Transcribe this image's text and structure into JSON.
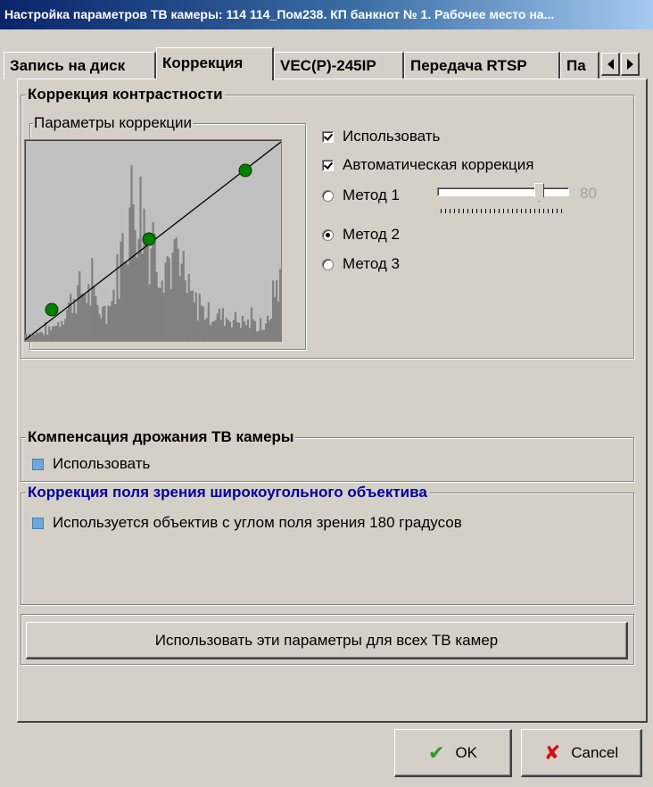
{
  "window": {
    "title": "Настройка параметров ТВ камеры: 114 114_Пом238. КП банкнот № 1. Рабочее место на..."
  },
  "tabs": [
    {
      "label": "Запись на диск",
      "active": false
    },
    {
      "label": "Коррекция",
      "active": true
    },
    {
      "label": "VEC(P)-245IP",
      "active": false
    },
    {
      "label": "Передача RTSP",
      "active": false
    },
    {
      "label": "Па",
      "active": false
    }
  ],
  "contrast": {
    "group_title": "Коррекция контрастности",
    "params_title": "Параметры коррекции",
    "use_label": "Использовать",
    "use_checked": true,
    "auto_label": "Автоматическая коррекция",
    "auto_checked": true,
    "methods": [
      {
        "label": "Метод 1",
        "selected": false
      },
      {
        "label": "Метод 2",
        "selected": true
      },
      {
        "label": "Метод 3",
        "selected": false
      }
    ],
    "slider_value": "80",
    "slider_level": 0.8
  },
  "shake": {
    "group_title": "Компенсация дрожания ТВ камеры",
    "use_label": "Использовать",
    "use_checked": false
  },
  "fisheye": {
    "group_title": "Коррекция поля зрения широкоугольного объектива",
    "lens_label": "Используется объектив с углом поля зрения 180 градусов",
    "lens_checked": false,
    "title_color": "#0000a0"
  },
  "buttons": {
    "apply_all": "Использовать эти параметры для всех ТВ камер",
    "ok": "OK",
    "cancel": "Cancel"
  },
  "icons": {
    "ok": "checkmark-icon",
    "cancel": "x-mark-icon"
  }
}
